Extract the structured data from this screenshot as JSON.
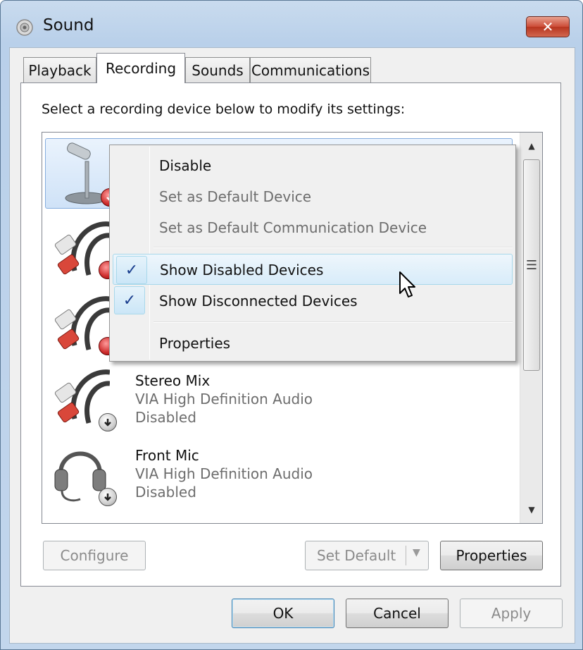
{
  "window": {
    "title": "Sound",
    "close_glyph": "✕"
  },
  "tabs": [
    {
      "label": "Playback",
      "active": false
    },
    {
      "label": "Recording",
      "active": true
    },
    {
      "label": "Sounds",
      "active": false
    },
    {
      "label": "Communications",
      "active": false
    }
  ],
  "recording": {
    "instructions": "Select a recording device below to modify its settings:",
    "devices": [
      {
        "name": "Stereo Mix",
        "driver": "VIA High Definition Audio",
        "status": "Disabled",
        "icon": "stereo-cable-icon"
      },
      {
        "name": "Front Mic",
        "driver": "VIA High Definition Audio",
        "status": "Disabled",
        "icon": "headset-icon"
      }
    ],
    "scroll": {
      "up": "▲",
      "down": "▼",
      "grip": "☰"
    }
  },
  "context_menu": {
    "items": [
      {
        "label": "Disable",
        "enabled": true,
        "checked": false
      },
      {
        "label": "Set as Default Device",
        "enabled": false,
        "checked": false
      },
      {
        "label": "Set as Default Communication Device",
        "enabled": false,
        "checked": false
      },
      {
        "label": "Show Disabled Devices",
        "enabled": true,
        "checked": true,
        "highlighted": true
      },
      {
        "label": "Show Disconnected Devices",
        "enabled": true,
        "checked": true
      },
      {
        "label": "Properties",
        "enabled": true,
        "checked": false
      }
    ],
    "check_glyph": "✓"
  },
  "panel_buttons": {
    "configure": "Configure",
    "set_default": "Set Default",
    "properties": "Properties"
  },
  "dialog_buttons": {
    "ok": "OK",
    "cancel": "Cancel",
    "apply": "Apply"
  },
  "colors": {
    "title_bar": "#b9d0ea",
    "close_button": "#cc4c37",
    "selection": "#cfe2f7",
    "menu_highlight": "#d8ecf9",
    "check_mark": "#1a3e8e"
  }
}
